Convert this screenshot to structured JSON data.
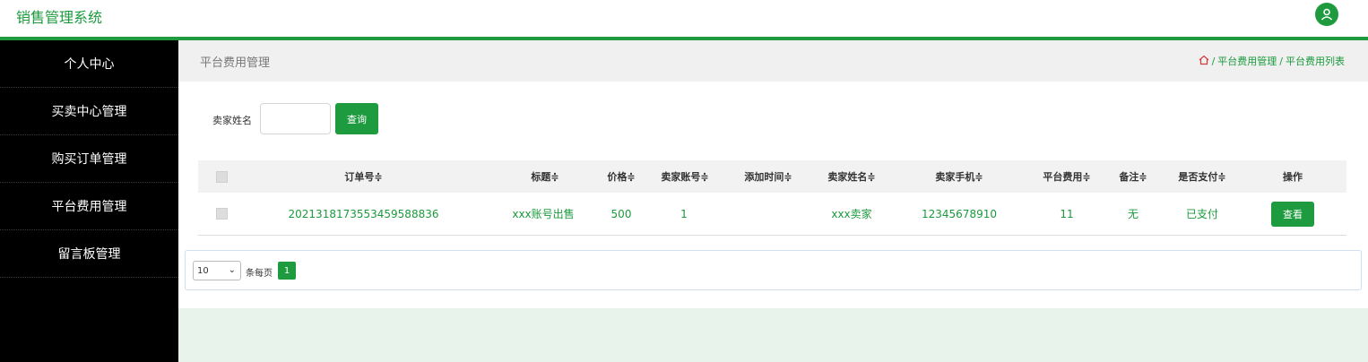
{
  "app": {
    "title": "销售管理系统"
  },
  "sidebar": {
    "items": [
      {
        "label": "个人中心"
      },
      {
        "label": "买卖中心管理"
      },
      {
        "label": "购买订单管理"
      },
      {
        "label": "平台费用管理"
      },
      {
        "label": "留言板管理"
      }
    ]
  },
  "header": {
    "page_title": "平台费用管理",
    "breadcrumb": [
      "平台费用管理",
      "平台费用列表"
    ],
    "breadcrumb_sep": "/"
  },
  "search": {
    "label": "卖家姓名",
    "value": "",
    "placeholder": "",
    "button_label": "查询"
  },
  "table": {
    "columns": [
      "订单号",
      "标题",
      "价格",
      "卖家账号",
      "添加时间",
      "卖家姓名",
      "卖家手机",
      "平台费用",
      "备注",
      "是否支付",
      "操作"
    ],
    "sort_glyph": "≑",
    "rows": [
      {
        "order_no": "2021318173553459588836",
        "title": "xxx账号出售",
        "price": "500",
        "seller_account": "1",
        "added_time": "",
        "seller_name": "xxx卖家",
        "seller_phone": "12345678910",
        "platform_fee": "11",
        "note": "无",
        "paid": "已支付",
        "action": "查看"
      }
    ]
  },
  "pagination": {
    "page_size": "10",
    "per_page_label": "条每页",
    "current_page": "1"
  },
  "colors": {
    "accent": "#1e9b3e",
    "sidebar_bg": "#000000",
    "link_green": "#1a9a3c",
    "footer_band": "#e8f3ec"
  },
  "icons": {
    "user": "user-icon",
    "home": "home-icon",
    "chevron": "chevron-down-icon"
  }
}
